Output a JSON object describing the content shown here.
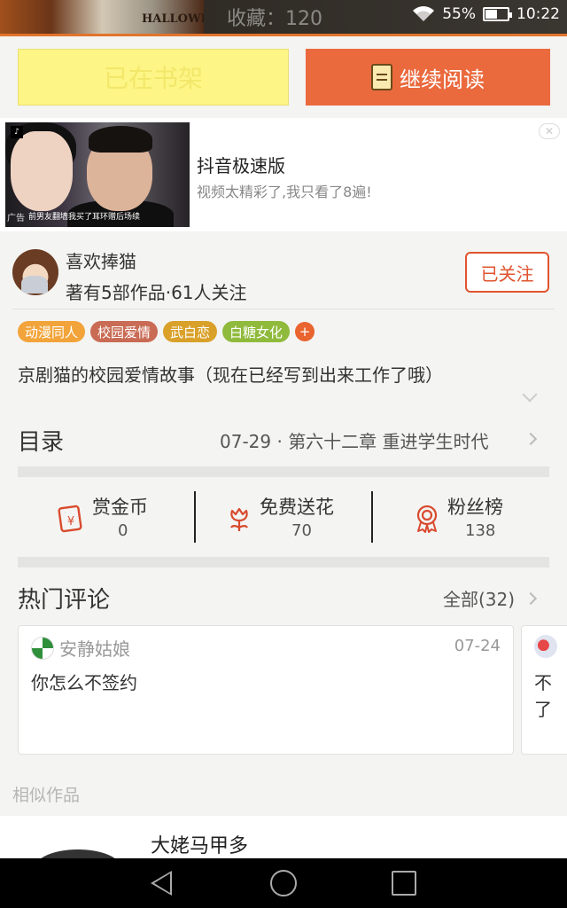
{
  "status_bar": {
    "collect_label": "收藏",
    "collect_sep": "：",
    "collect_count": "120",
    "thumb_text": "HALLOWE",
    "battery_percent": "55%",
    "battery_level": 0.55,
    "time": "10:22"
  },
  "actions": {
    "shelf_label": "已在书架",
    "read_label": "继续阅读"
  },
  "ad": {
    "title": "抖音极速版",
    "description": "视频太精彩了,我只看了8遍!",
    "caption": "前男友翻墙我买了耳环赠后场续",
    "tag": "广告",
    "logo": "♪",
    "close_icon": "✕"
  },
  "author": {
    "name": "喜欢捧猫",
    "meta": "著有5部作品·61人关注",
    "follow_label": "已关注"
  },
  "tags": [
    {
      "label": "动漫同人",
      "color": "#f2a43a"
    },
    {
      "label": "校园爱情",
      "color": "#c96b55"
    },
    {
      "label": "武白恋",
      "color": "#d9a12a"
    },
    {
      "label": "白糖女化",
      "color": "#8fba3c"
    }
  ],
  "tag_plus": "+",
  "summary": "京剧猫的校园爱情故事（现在已经写到出来工作了哦）",
  "catalog": {
    "title": "目录",
    "latest": "07-29 · 第六十二章 重进学生时代"
  },
  "stats": [
    {
      "label": "赏金币",
      "value": "0",
      "icon": "reward-coin-icon"
    },
    {
      "label": "免费送花",
      "value": "70",
      "icon": "flower-icon"
    },
    {
      "label": "粉丝榜",
      "value": "138",
      "icon": "medal-icon"
    }
  ],
  "comments": {
    "title": "热门评论",
    "all_label": "全部(32)",
    "items": [
      {
        "user": "安静姑娘",
        "date": "07-24",
        "text": "你怎么不签约"
      },
      {
        "user": "",
        "date": "",
        "text_line1": "不",
        "text_line2": "了"
      }
    ]
  },
  "similar": {
    "title": "相似作品",
    "first_name": "大姥马甲多"
  },
  "colors": {
    "accent": "#ea6a3e",
    "shelf_button": "#fdf585",
    "follow": "#e0542e",
    "icon_red": "#d94a2e"
  }
}
